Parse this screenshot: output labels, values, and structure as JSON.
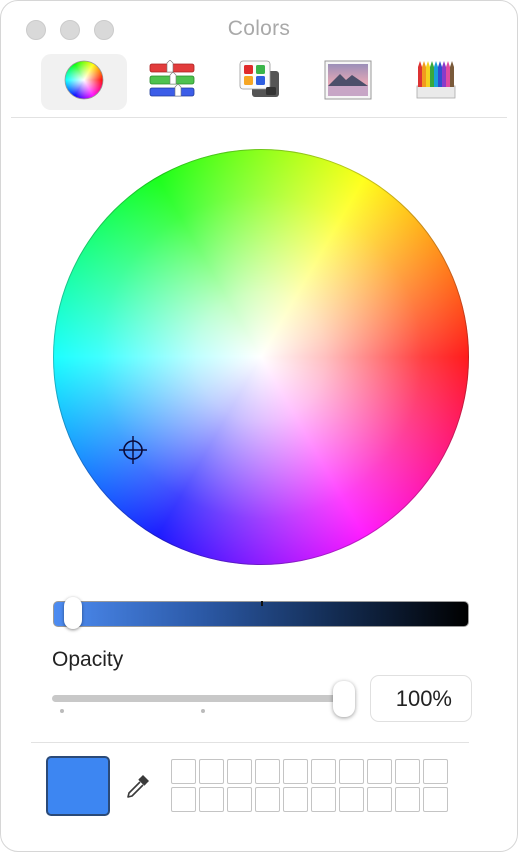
{
  "window": {
    "title": "Colors",
    "traffic_lights": [
      "close",
      "minimize",
      "zoom"
    ]
  },
  "toolbar": {
    "modes": [
      {
        "id": "color-wheel",
        "icon": "color-wheel-icon",
        "active": true
      },
      {
        "id": "color-sliders",
        "icon": "color-sliders-icon",
        "active": false
      },
      {
        "id": "color-palettes",
        "icon": "color-palettes-icon",
        "active": false
      },
      {
        "id": "image-palettes",
        "icon": "image-palettes-icon",
        "active": false
      },
      {
        "id": "pencils",
        "icon": "pencils-icon",
        "active": false
      }
    ]
  },
  "wheel": {
    "selected_color": "#3d86f2"
  },
  "brightness": {
    "level": 0.05
  },
  "opacity": {
    "label": "Opacity",
    "value": "100%",
    "level": 1.0
  },
  "current_color": {
    "hex": "#3d86f2"
  },
  "swatches": {
    "rows": 2,
    "cols": 10,
    "colors": []
  }
}
